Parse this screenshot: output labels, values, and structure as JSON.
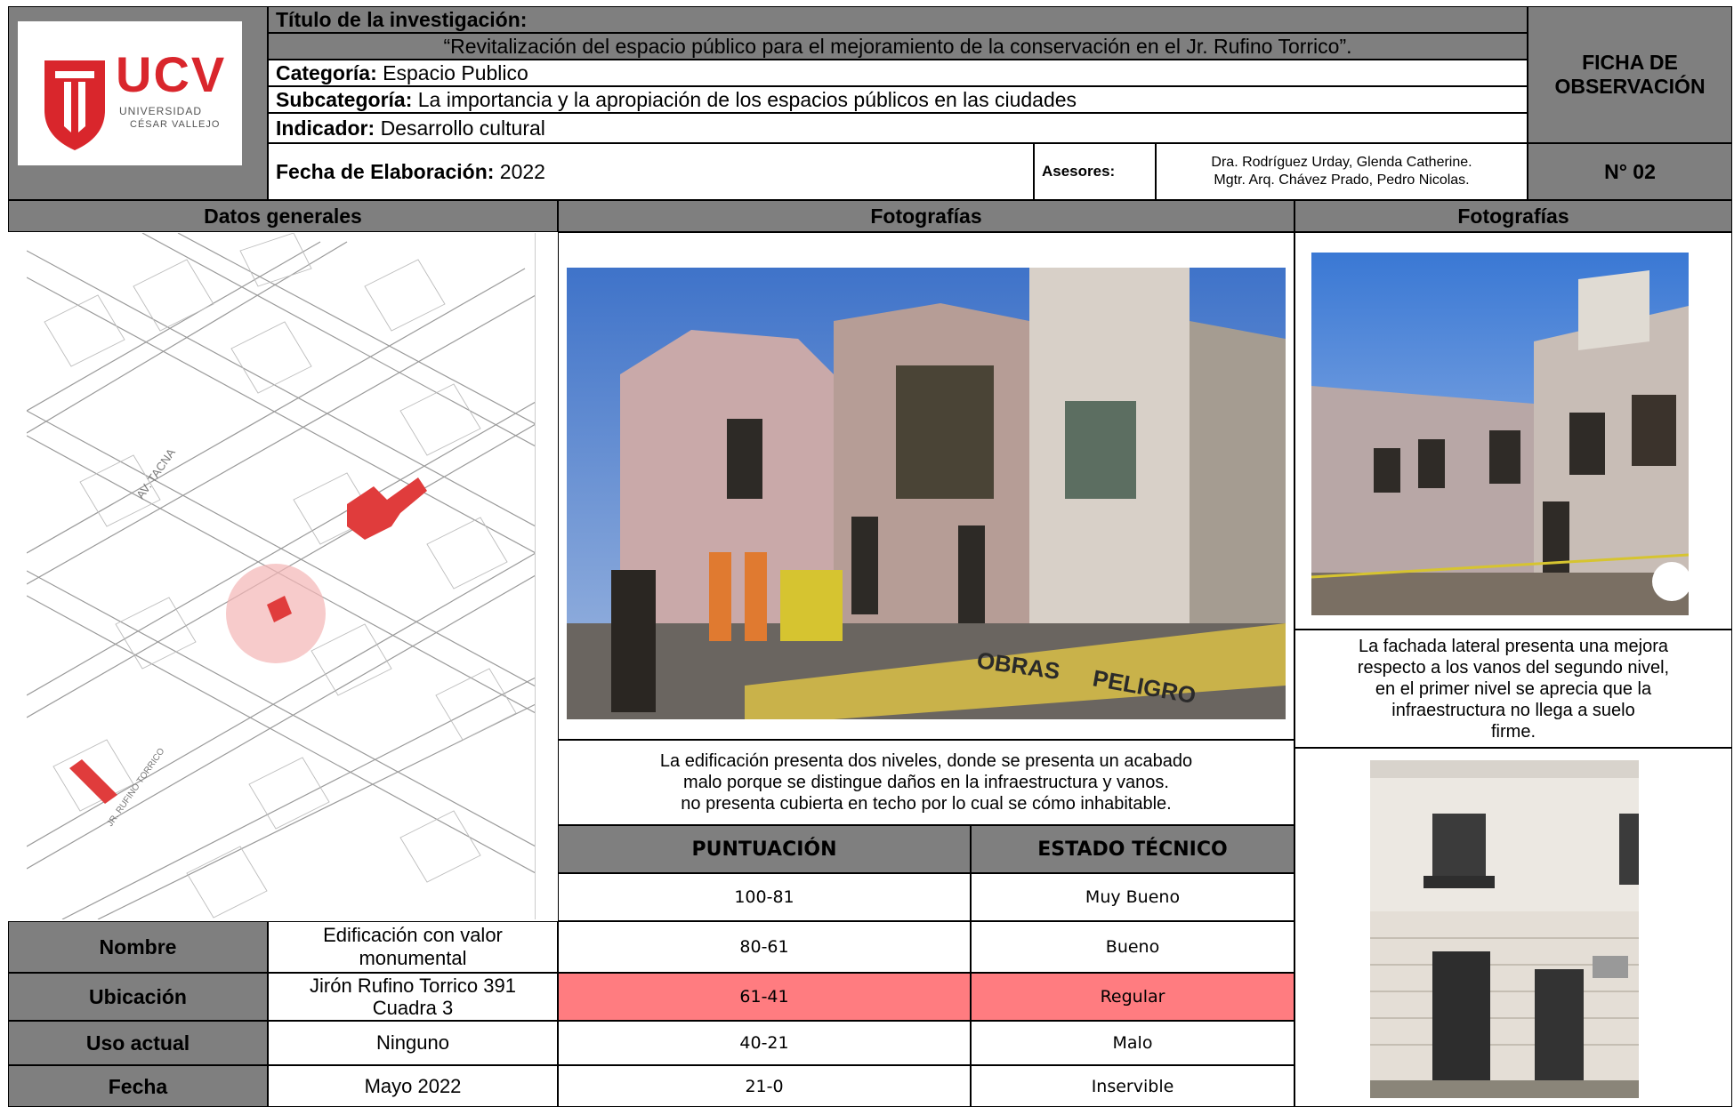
{
  "logo": {
    "brand": "UCV",
    "sub1": "UNIVERSIDAD",
    "sub2": "CÉSAR VALLEJO",
    "color": "#d9262c"
  },
  "header": {
    "titulo_label": "Título de la investigación:",
    "titulo_value": "“Revitalización del espacio público para el mejoramiento de la conservación en el Jr. Rufino Torrico”.",
    "categoria_label": "Categoría:",
    "categoria_value": "Espacio Publico",
    "subcategoria_label": "Subcategoría:",
    "subcategoria_value": "La importancia y la apropiación de los espacios públicos en las ciudades",
    "indicador_label": "Indicador:",
    "indicador_value": "Desarrollo cultural",
    "fecha_label": "Fecha de Elaboración:",
    "fecha_value": "2022",
    "asesores_label": "Asesores:",
    "asesor1": "Dra. Rodríguez Urday, Glenda Catherine.",
    "asesor2": "Mgtr. Arq. Chávez Prado, Pedro Nicolas.",
    "ficha_line1": "FICHA DE",
    "ficha_line2": "OBSERVACIÓN",
    "numero": "N° 02"
  },
  "sections": {
    "datos_generales": "Datos generales",
    "fotografias_1": "Fotografías",
    "fotografias_2": "Fotografías"
  },
  "map": {
    "street1": "AV. TACNA",
    "street2": "JR. RUFINO TORRICO",
    "highlight_color": "#e03c3c"
  },
  "photo_main": {
    "sign1": "OBRAS",
    "sign2": "PELIGRO"
  },
  "captions": {
    "main_line1": "La edificación presenta dos niveles, donde se presenta un acabado",
    "main_line2": "malo porque se distingue daños en la infraestructura y vanos.",
    "main_line3": "no presenta cubierta en techo por lo cual se cómo inhabitable.",
    "side_line1": "La fachada lateral presenta una mejora",
    "side_line2": "respecto a los vanos del segundo nivel,",
    "side_line3": "en el primer nivel se aprecia que la",
    "side_line4": "infraestructura no llega a suelo",
    "side_line5": "firme."
  },
  "rating": {
    "header_score": "PUNTUACIÓN",
    "header_state": "ESTADO TÉCNICO",
    "highlight_color": "#ff7c80",
    "rows": [
      {
        "score": "100-81",
        "state": "Muy Bueno"
      },
      {
        "score": "80-61",
        "state": "Bueno"
      },
      {
        "score": "61-41",
        "state": "Regular"
      },
      {
        "score": "40-21",
        "state": "Malo"
      },
      {
        "score": "21-0",
        "state": "Inservible"
      }
    ]
  },
  "info": {
    "nombre_label": "Nombre",
    "nombre_line1": "Edificación con valor",
    "nombre_line2": "monumental",
    "ubicacion_label": "Ubicación",
    "ubicacion_line1": "Jirón Rufino Torrico 391",
    "ubicacion_line2": "Cuadra 3",
    "uso_label": "Uso actual",
    "uso_value": "Ninguno",
    "fecha_label": "Fecha",
    "fecha_value": "Mayo 2022"
  }
}
